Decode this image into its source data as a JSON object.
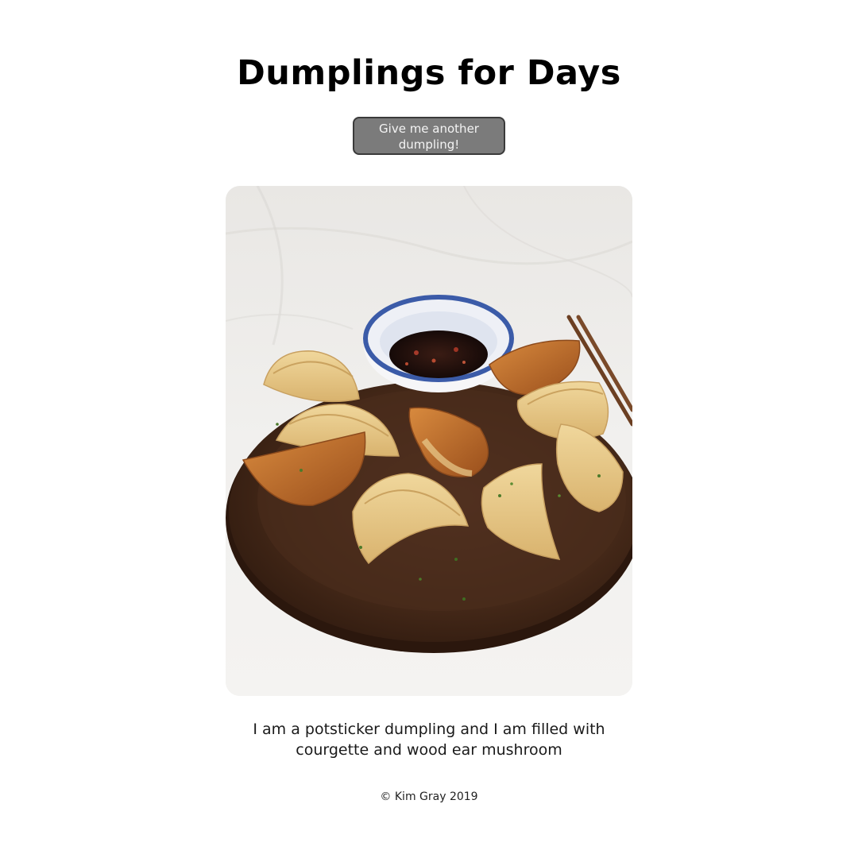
{
  "header": {
    "title": "Dumplings for Days"
  },
  "controls": {
    "another_button_label": "Give me another dumpling!"
  },
  "photo": {
    "subject": "pan-fried potsticker dumplings on a round wooden board with a blue-and-white bowl of dipping sauce and chopsticks"
  },
  "caption": {
    "text": "I am a potsticker dumpling and I am filled with courgette and wood ear mushroom"
  },
  "footer": {
    "copyright": "© Kim Gray 2019"
  },
  "colors": {
    "button_bg": "#7b7b7b",
    "button_border": "#3a3a3a",
    "title": "#000000",
    "board": "#4a2c1c",
    "dumpling": "#e3c27f",
    "dumpling_seared": "#b86a2c",
    "bowl_rim": "#3b5ba8"
  }
}
